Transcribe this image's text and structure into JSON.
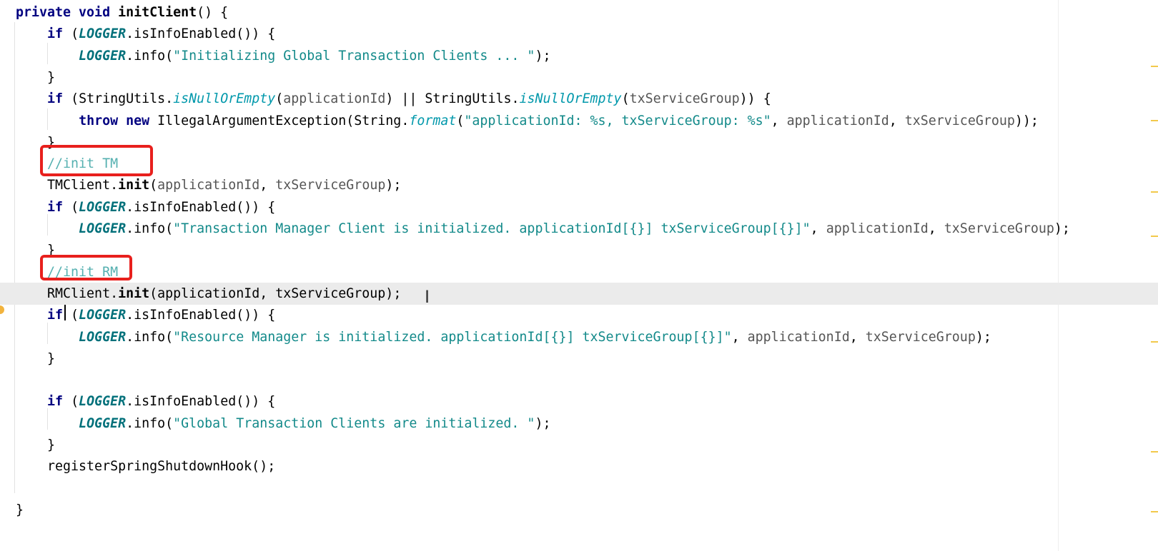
{
  "editor": {
    "lines": [
      {
        "tokens": [
          {
            "t": "private void ",
            "c": "k"
          },
          {
            "t": "initClient",
            "c": "f"
          },
          {
            "t": "() {",
            "c": ""
          }
        ]
      },
      {
        "tokens": [
          {
            "t": "    ",
            "c": ""
          },
          {
            "t": "if ",
            "c": "k"
          },
          {
            "t": "(",
            "c": ""
          },
          {
            "t": "LOGGER",
            "c": "st"
          },
          {
            "t": ".isInfoEnabled()) {",
            "c": ""
          }
        ]
      },
      {
        "tokens": [
          {
            "t": "        ",
            "c": ""
          },
          {
            "t": "LOGGER",
            "c": "st"
          },
          {
            "t": ".info(",
            "c": ""
          },
          {
            "t": "\"Initializing Global Transaction Clients ... \"",
            "c": "s"
          },
          {
            "t": ");",
            "c": ""
          }
        ]
      },
      {
        "tokens": [
          {
            "t": "    }",
            "c": ""
          }
        ]
      },
      {
        "tokens": [
          {
            "t": "    ",
            "c": ""
          },
          {
            "t": "if ",
            "c": "k"
          },
          {
            "t": "(StringUtils.",
            "c": ""
          },
          {
            "t": "isNullOrEmpty",
            "c": "c"
          },
          {
            "t": "(",
            "c": ""
          },
          {
            "t": "applicationId",
            "c": "pn"
          },
          {
            "t": ") || StringUtils.",
            "c": ""
          },
          {
            "t": "isNullOrEmpty",
            "c": "c"
          },
          {
            "t": "(",
            "c": ""
          },
          {
            "t": "txServiceGroup",
            "c": "pn"
          },
          {
            "t": ")) {",
            "c": ""
          }
        ]
      },
      {
        "tokens": [
          {
            "t": "        ",
            "c": ""
          },
          {
            "t": "throw new ",
            "c": "k"
          },
          {
            "t": "IllegalArgumentException(String.",
            "c": ""
          },
          {
            "t": "format",
            "c": "c"
          },
          {
            "t": "(",
            "c": ""
          },
          {
            "t": "\"applicationId: %s, txServiceGroup: %s\"",
            "c": "s"
          },
          {
            "t": ", ",
            "c": ""
          },
          {
            "t": "applicationId",
            "c": "pn"
          },
          {
            "t": ", ",
            "c": ""
          },
          {
            "t": "txServiceGroup",
            "c": "pn"
          },
          {
            "t": "));",
            "c": ""
          }
        ]
      },
      {
        "tokens": [
          {
            "t": "    }",
            "c": ""
          }
        ]
      },
      {
        "tokens": [
          {
            "t": "    ",
            "c": ""
          },
          {
            "t": "//init TM",
            "c": "cm"
          }
        ]
      },
      {
        "tokens": [
          {
            "t": "    TMClient.",
            "c": ""
          },
          {
            "t": "init",
            "c": "f"
          },
          {
            "t": "(",
            "c": ""
          },
          {
            "t": "applicationId",
            "c": "pn"
          },
          {
            "t": ", ",
            "c": ""
          },
          {
            "t": "txServiceGroup",
            "c": "pn"
          },
          {
            "t": ");",
            "c": ""
          }
        ]
      },
      {
        "tokens": [
          {
            "t": "    ",
            "c": ""
          },
          {
            "t": "if ",
            "c": "k"
          },
          {
            "t": "(",
            "c": ""
          },
          {
            "t": "LOGGER",
            "c": "st"
          },
          {
            "t": ".isInfoEnabled()) {",
            "c": ""
          }
        ]
      },
      {
        "tokens": [
          {
            "t": "        ",
            "c": ""
          },
          {
            "t": "LOGGER",
            "c": "st"
          },
          {
            "t": ".info(",
            "c": ""
          },
          {
            "t": "\"Transaction Manager Client is initialized. applicationId[{}] txServiceGroup[{}]\"",
            "c": "s"
          },
          {
            "t": ", ",
            "c": ""
          },
          {
            "t": "applicationId",
            "c": "pn"
          },
          {
            "t": ", ",
            "c": ""
          },
          {
            "t": "txServiceGroup",
            "c": "pn"
          },
          {
            "t": ");",
            "c": ""
          }
        ]
      },
      {
        "tokens": [
          {
            "t": "    }",
            "c": ""
          }
        ]
      },
      {
        "tokens": [
          {
            "t": "    ",
            "c": ""
          },
          {
            "t": "//init RM",
            "c": "cm"
          }
        ]
      },
      {
        "tokens": [
          {
            "t": "    RMClient.",
            "c": ""
          },
          {
            "t": "init",
            "c": "f"
          },
          {
            "t": "(applicationId, txServiceGroup);",
            "c": ""
          }
        ]
      },
      {
        "tokens": [
          {
            "t": "    ",
            "c": ""
          },
          {
            "t": "if",
            "c": "k"
          },
          {
            "t": " (",
            "c": ""
          },
          {
            "t": "LOGGER",
            "c": "st"
          },
          {
            "t": ".isInfoEnabled()) {",
            "c": ""
          }
        ]
      },
      {
        "tokens": [
          {
            "t": "        ",
            "c": ""
          },
          {
            "t": "LOGGER",
            "c": "st"
          },
          {
            "t": ".info(",
            "c": ""
          },
          {
            "t": "\"Resource Manager is initialized. applicationId[{}] txServiceGroup[{}]\"",
            "c": "s"
          },
          {
            "t": ", ",
            "c": ""
          },
          {
            "t": "applicationId",
            "c": "pn"
          },
          {
            "t": ", ",
            "c": ""
          },
          {
            "t": "txServiceGroup",
            "c": "pn"
          },
          {
            "t": ");",
            "c": ""
          }
        ]
      },
      {
        "tokens": [
          {
            "t": "    }",
            "c": ""
          }
        ]
      },
      {
        "tokens": []
      },
      {
        "tokens": [
          {
            "t": "    ",
            "c": ""
          },
          {
            "t": "if ",
            "c": "k"
          },
          {
            "t": "(",
            "c": ""
          },
          {
            "t": "LOGGER",
            "c": "st"
          },
          {
            "t": ".isInfoEnabled()) {",
            "c": ""
          }
        ]
      },
      {
        "tokens": [
          {
            "t": "        ",
            "c": ""
          },
          {
            "t": "LOGGER",
            "c": "st"
          },
          {
            "t": ".info(",
            "c": ""
          },
          {
            "t": "\"Global Transaction Clients are initialized. \"",
            "c": "s"
          },
          {
            "t": ");",
            "c": ""
          }
        ]
      },
      {
        "tokens": [
          {
            "t": "    }",
            "c": ""
          }
        ]
      },
      {
        "tokens": [
          {
            "t": "    registerSpringShutdownHook();",
            "c": ""
          }
        ]
      },
      {
        "tokens": []
      },
      {
        "tokens": [
          {
            "t": "}",
            "c": ""
          }
        ]
      }
    ],
    "current_line_index": 13,
    "highlighted_line_indices": [
      7,
      12
    ]
  },
  "colors": {
    "keyword": "#000080",
    "string": "#138a8a",
    "comment": "#55b0b0",
    "static_field": "#00707a",
    "highlight_box": "#e8201d",
    "current_line": "#ebebeb"
  }
}
